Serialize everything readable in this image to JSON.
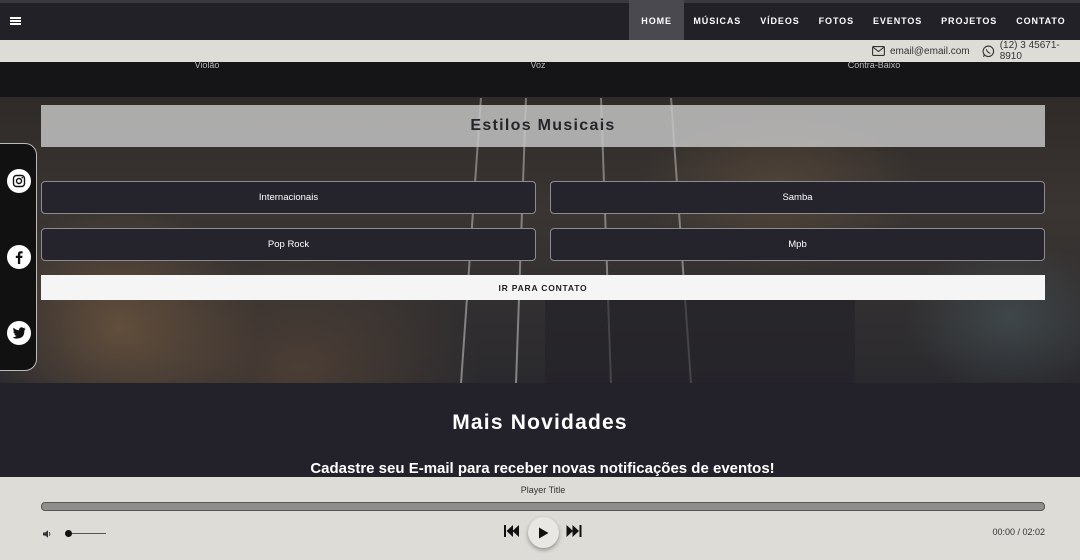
{
  "nav": {
    "items": [
      {
        "label": "HOME",
        "active": true
      },
      {
        "label": "MÚSICAS",
        "active": false
      },
      {
        "label": "VÍDEOS",
        "active": false
      },
      {
        "label": "FOTOS",
        "active": false
      },
      {
        "label": "EVENTOS",
        "active": false
      },
      {
        "label": "PROJETOS",
        "active": false
      },
      {
        "label": "CONTATO",
        "active": false
      }
    ],
    "menu_icon": "hamburger-icon"
  },
  "contact": {
    "email": "email@email.com",
    "phone": "(12) 3 45671-8910",
    "email_icon": "envelope-icon",
    "phone_icon": "whatsapp-icon"
  },
  "instruments": [
    "Violão",
    "Voz",
    "Contra-Baixo"
  ],
  "styles": {
    "title": "Estilos Musicais",
    "buttons": [
      "Internacionais",
      "Samba",
      "Pop Rock",
      "Mpb"
    ],
    "contact_button": "IR PARA CONTATO"
  },
  "social": [
    "instagram-icon",
    "facebook-icon",
    "twitter-icon"
  ],
  "news": {
    "title": "Mais Novidades",
    "subtitle": "Cadastre seu E-mail para receber novas notificações de eventos!"
  },
  "player": {
    "title": "Player Title",
    "time": "00:00 / 02:02",
    "progress": 0,
    "volume": 0.05
  },
  "colors": {
    "nav_bg": "#222127",
    "nav_active": "#4a494f",
    "bar_bg": "#dddcd7",
    "page_bg": "#23212a"
  }
}
